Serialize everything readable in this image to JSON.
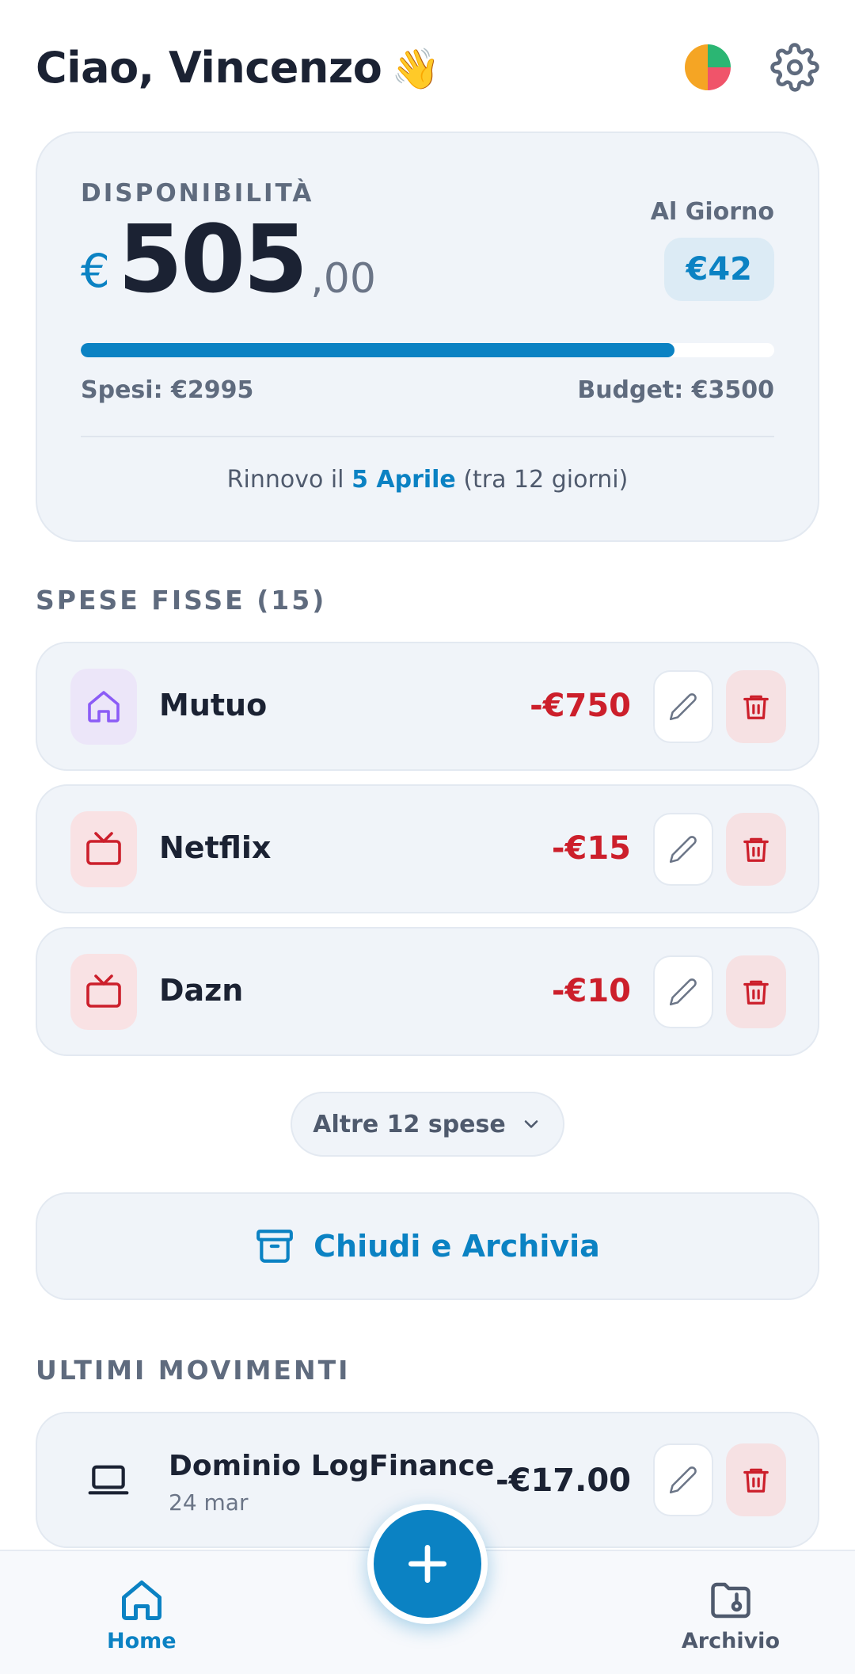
{
  "header": {
    "greeting": "Ciao, Vincenzo",
    "wave_emoji": "👋",
    "stats_icon": "pie-chart-icon",
    "settings_icon": "gear-icon"
  },
  "budget_card": {
    "label": "DISPONIBILITÀ",
    "currency_symbol": "€",
    "amount_integer": "505",
    "amount_decimal": ",00",
    "per_day_label": "Al Giorno",
    "per_day_value": "€42",
    "progress_fraction": 0.856,
    "spent_text": "Spesi: €2995",
    "budget_text": "Budget: €3500",
    "renewal_prefix": "Rinnovo il ",
    "renewal_date": "5 Aprile",
    "renewal_suffix": " (tra 12 giorni)"
  },
  "fixed_expenses": {
    "title": "SPESE FISSE (15)",
    "items": [
      {
        "name": "Mutuo",
        "amount": "-€750",
        "icon": "home-icon"
      },
      {
        "name": "Netflix",
        "amount": "-€15",
        "icon": "tv-icon"
      },
      {
        "name": "Dazn",
        "amount": "-€10",
        "icon": "tv-icon"
      }
    ],
    "more_label": "Altre 12 spese"
  },
  "archive_button": {
    "label": "Chiudi e Archivia",
    "icon": "archive-box-icon"
  },
  "movements": {
    "title": "ULTIMI MOVIMENTI",
    "items": [
      {
        "title": "Dominio LogFinance",
        "date": "24 mar",
        "amount": "-€17.00",
        "icon": "laptop-icon"
      }
    ]
  },
  "bottom_nav": {
    "home_label": "Home",
    "archive_label": "Archivio",
    "fab_icon": "plus-icon"
  },
  "colors": {
    "accent": "#0b82c3",
    "negative": "#cc1f2b",
    "card_bg": "#f0f4f9",
    "text_dark": "#1b2233",
    "text_muted": "#5f6b7e"
  }
}
